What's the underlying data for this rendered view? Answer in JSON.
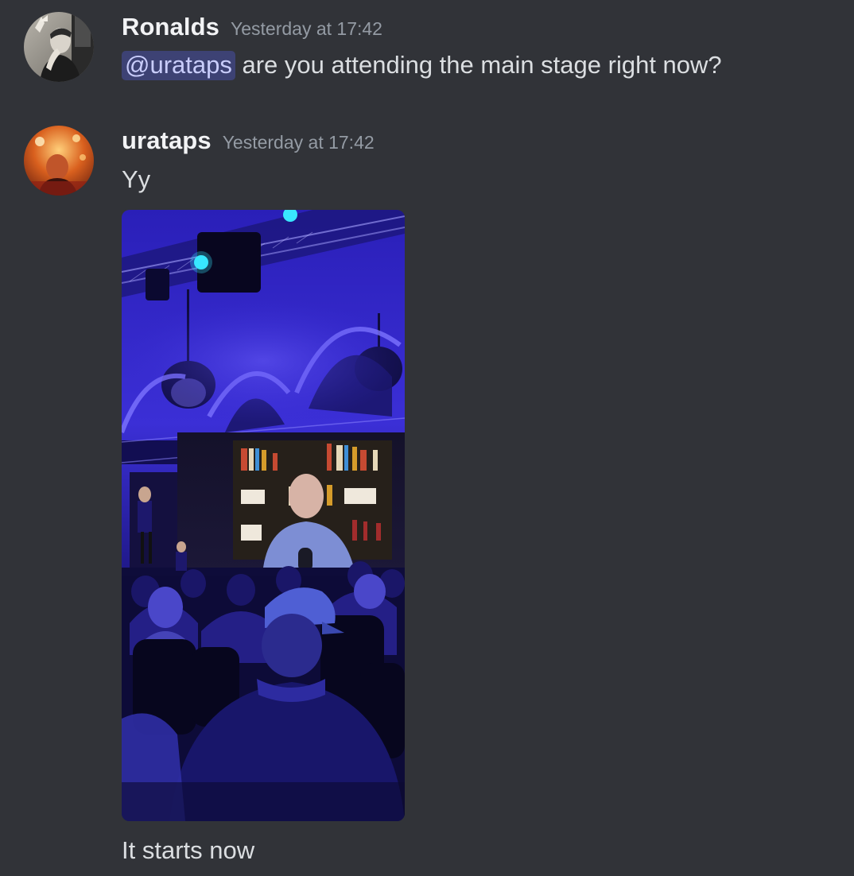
{
  "messages": [
    {
      "username": "Ronalds",
      "timestamp": "Yesterday at 17:42",
      "mention": "@urataps",
      "text": " are you attending the main stage right now?"
    },
    {
      "username": "urataps",
      "timestamp": "Yesterday at 17:42",
      "text": "Yy",
      "followup_text": "It starts now"
    }
  ],
  "colors": {
    "background": "#313338",
    "username": "#f2f3f5",
    "timestamp": "#949ba4",
    "text": "#dbdee1",
    "mention_bg": "#3e4270",
    "mention_text": "#c9cdfb"
  }
}
